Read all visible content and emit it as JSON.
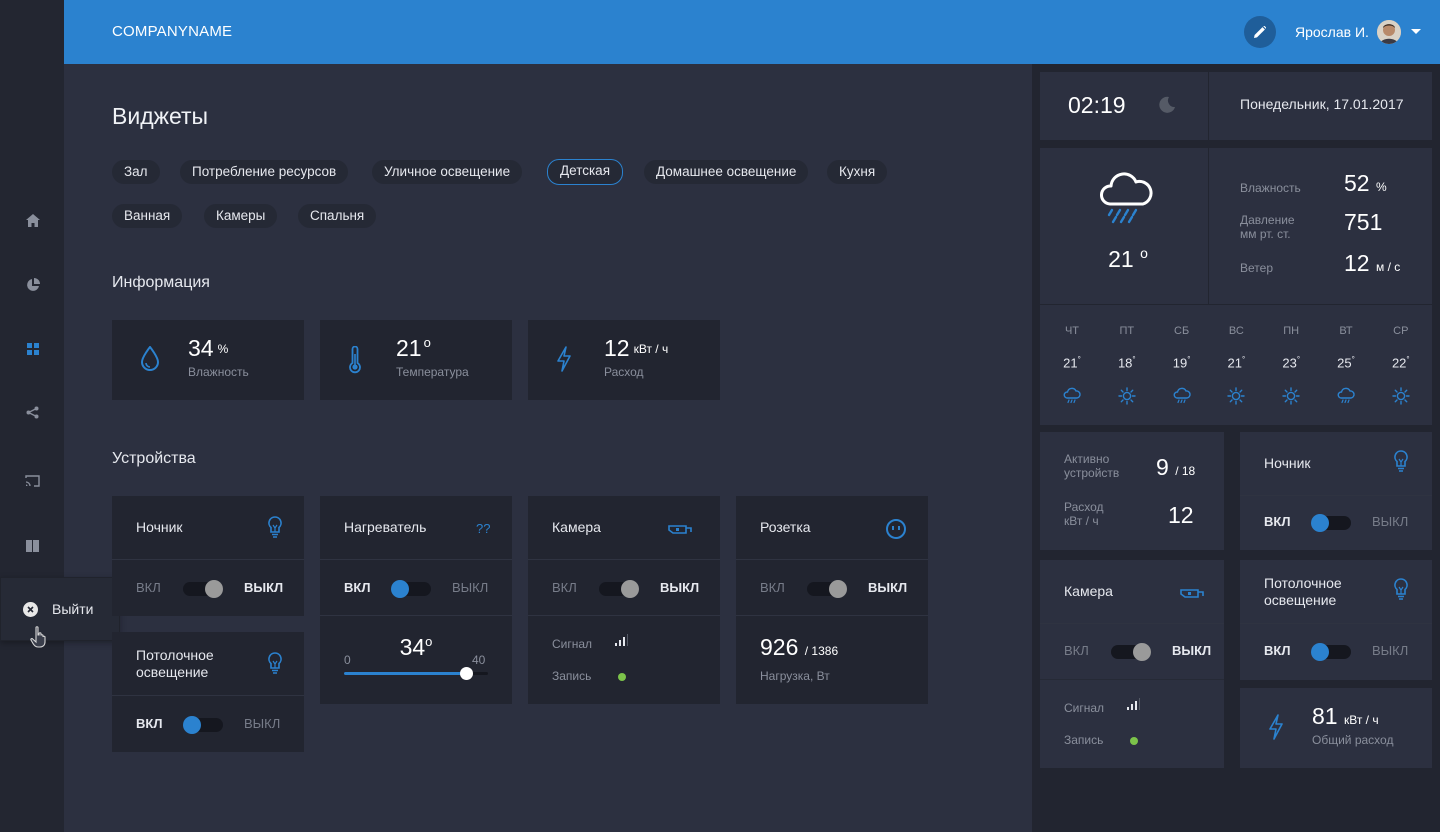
{
  "header": {
    "brand": "COMPANYNAME",
    "user_name": "Ярослав И.",
    "accent": "#2b82cf"
  },
  "sidebar": {
    "icons": [
      "home-icon",
      "pie-chart-icon",
      "grid-icon",
      "share-icon",
      "cast-icon",
      "book-icon"
    ],
    "logout_label": "Выйти"
  },
  "main": {
    "title": "Виджеты",
    "tabs": [
      {
        "label": "Зал"
      },
      {
        "label": "Потребление ресурсов"
      },
      {
        "label": "Уличное освещение"
      },
      {
        "label": "Детская",
        "active": true
      },
      {
        "label": "Домашнее освещение"
      },
      {
        "label": "Кухня"
      },
      {
        "label": "Ванная"
      },
      {
        "label": "Камеры"
      },
      {
        "label": "Спальня"
      }
    ],
    "info_title": "Информация",
    "info": [
      {
        "value": "34",
        "unit": "%",
        "label": "Влажность",
        "icon": "drop-icon"
      },
      {
        "value": "21",
        "unit": "о",
        "label": "Температура",
        "icon": "thermometer-icon"
      },
      {
        "value": "12",
        "unit": "кВт / ч",
        "label": "Расход",
        "icon": "bolt-icon"
      }
    ],
    "devices_title": "Устройства",
    "devices": {
      "nightlight": {
        "title": "Ночник",
        "on": "ВКЛ",
        "off": "ВЫКЛ",
        "state": "off"
      },
      "ceiling": {
        "title": "Потолочное освещение",
        "on": "ВКЛ",
        "off": "ВЫКЛ",
        "state": "on"
      },
      "heater": {
        "title": "Нагреватель",
        "badge": "??",
        "on": "ВКЛ",
        "off": "ВЫКЛ",
        "state": "on",
        "temp": "34",
        "temp_unit": "о",
        "min": "0",
        "max": "40",
        "level": 34
      },
      "camera": {
        "title": "Камера",
        "on": "ВКЛ",
        "off": "ВЫКЛ",
        "state": "off",
        "signal_label": "Сигнал",
        "record_label": "Запись"
      },
      "socket": {
        "title": "Розетка",
        "on": "ВКЛ",
        "off": "ВЫКЛ",
        "state": "off",
        "load": "926",
        "load_max": "/ 1386",
        "load_label": "Нагрузка, Вт"
      }
    }
  },
  "right": {
    "time": "02:19",
    "date": "Понедельник, 17.01.2017",
    "weather": {
      "temp": "21",
      "temp_unit": "о",
      "humidity_label": "Влажность",
      "humidity": "52",
      "humidity_unit": "%",
      "pressure_label_1": "Давление",
      "pressure_label_2": "мм рт. ст.",
      "pressure": "751",
      "wind_label": "Ветер",
      "wind": "12",
      "wind_unit": "м / с"
    },
    "forecast": [
      {
        "day": "ЧТ",
        "temp": "21",
        "icon": "rain-icon"
      },
      {
        "day": "ПТ",
        "temp": "18",
        "icon": "sun-icon"
      },
      {
        "day": "СБ",
        "temp": "19",
        "icon": "rain-icon"
      },
      {
        "day": "ВС",
        "temp": "21",
        "icon": "sun-icon"
      },
      {
        "day": "ПН",
        "temp": "23",
        "icon": "sun-icon"
      },
      {
        "day": "ВТ",
        "temp": "25",
        "icon": "rain-icon"
      },
      {
        "day": "СР",
        "temp": "22",
        "icon": "sun-icon"
      }
    ],
    "active_label_1": "Активно",
    "active_label_2": "устройств",
    "active_value": "9",
    "active_total": "/ 18",
    "usage_label_1": "Расход",
    "usage_label_2": "кВт / ч",
    "usage_value": "12",
    "nightlight": {
      "title": "Ночник",
      "on": "ВКЛ",
      "off": "ВЫКЛ",
      "state": "on"
    },
    "camera": {
      "title": "Камера",
      "on": "ВКЛ",
      "off": "ВЫКЛ",
      "state": "off",
      "signal_label": "Сигнал",
      "record_label": "Запись"
    },
    "ceiling": {
      "title_1": "Потолочное",
      "title_2": "освещение",
      "on": "ВКЛ",
      "off": "ВЫКЛ",
      "state": "on"
    },
    "total": {
      "value": "81",
      "unit": "кВт / ч",
      "label": "Общий расход"
    }
  }
}
